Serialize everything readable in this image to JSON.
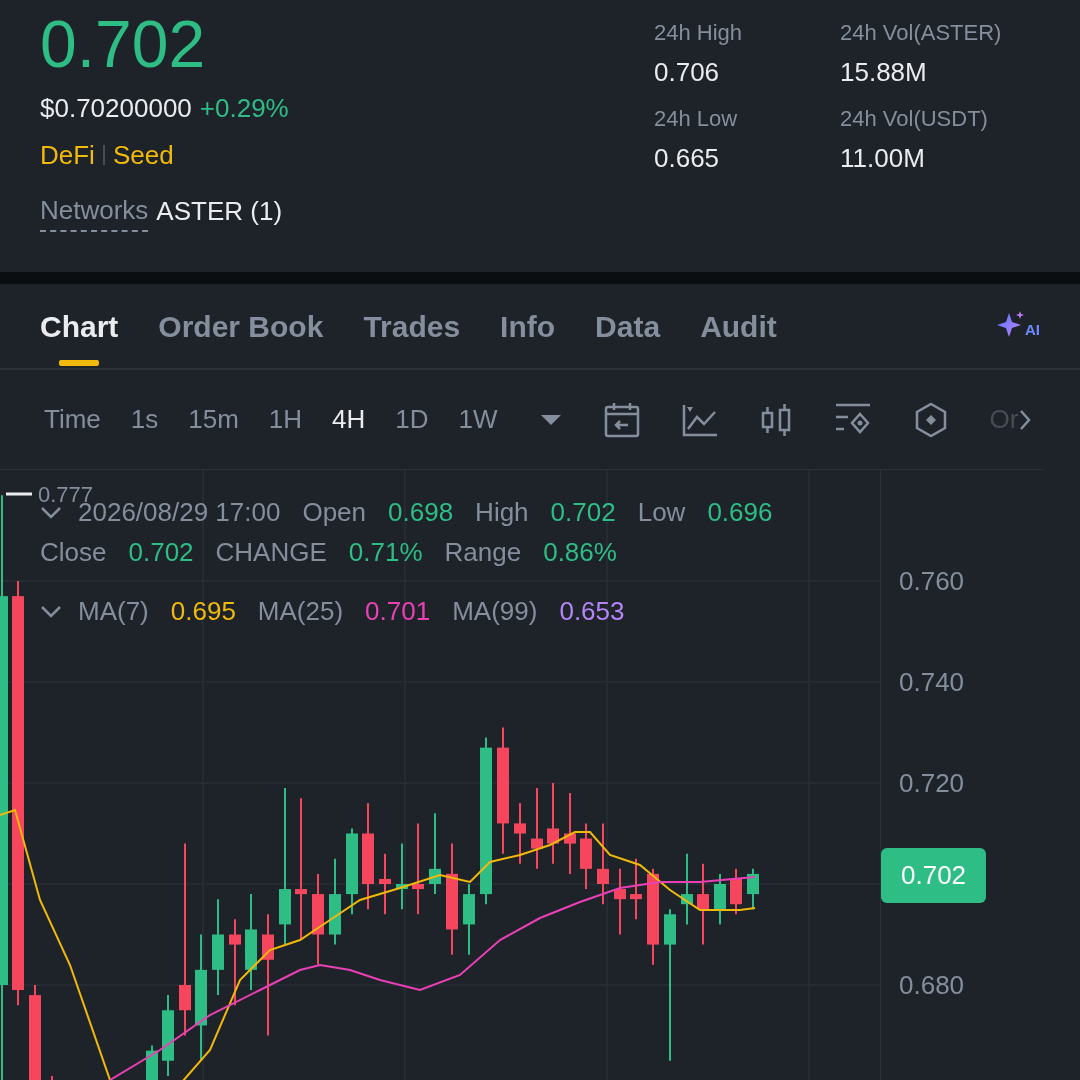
{
  "ticker": {
    "price": "0.702",
    "usd_price": "$0.70200000",
    "change": "+0.29%",
    "tags": [
      "DeFi",
      "Seed"
    ],
    "networks_label": "Networks",
    "networks_value": "ASTER (1)"
  },
  "stats": [
    {
      "label": "24h High",
      "value": "0.706"
    },
    {
      "label": "24h Vol(ASTER)",
      "value": "15.88M"
    },
    {
      "label": "24h Low",
      "value": "0.665"
    },
    {
      "label": "24h Vol(USDT)",
      "value": "11.00M"
    }
  ],
  "tabs": [
    {
      "label": "Chart",
      "selected": true
    },
    {
      "label": "Order Book",
      "selected": false
    },
    {
      "label": "Trades",
      "selected": false
    },
    {
      "label": "Info",
      "selected": false
    },
    {
      "label": "Data",
      "selected": false
    },
    {
      "label": "Audit",
      "selected": false
    }
  ],
  "ai_button": {
    "label": "AI"
  },
  "intervals": [
    {
      "label": "Time",
      "selected": false
    },
    {
      "label": "1s",
      "selected": false
    },
    {
      "label": "15m",
      "selected": false
    },
    {
      "label": "1H",
      "selected": false
    },
    {
      "label": "4H",
      "selected": true
    },
    {
      "label": "1D",
      "selected": false
    },
    {
      "label": "1W",
      "selected": false
    }
  ],
  "toolbar_more": "Or",
  "chart": {
    "high_marker": "0.777",
    "date": "2026/08/29 17:00",
    "fields": [
      {
        "label": "Open",
        "value": "0.698"
      },
      {
        "label": "High",
        "value": "0.702"
      },
      {
        "label": "Low",
        "value": "0.696"
      },
      {
        "label": "Close",
        "value": "0.702"
      },
      {
        "label": "CHANGE",
        "value": "0.71%"
      },
      {
        "label": "Range",
        "value": "0.86%"
      }
    ],
    "ma": [
      {
        "label": "MA(7)",
        "value": "0.695",
        "color": "#f0b90b"
      },
      {
        "label": "MA(25)",
        "value": "0.701",
        "color": "#eb40b5"
      },
      {
        "label": "MA(99)",
        "value": "0.653",
        "color": "#b385f6"
      }
    ],
    "price_axis": [
      "0.760",
      "0.740",
      "0.720",
      "0.680"
    ],
    "last_price": "0.702"
  }
}
